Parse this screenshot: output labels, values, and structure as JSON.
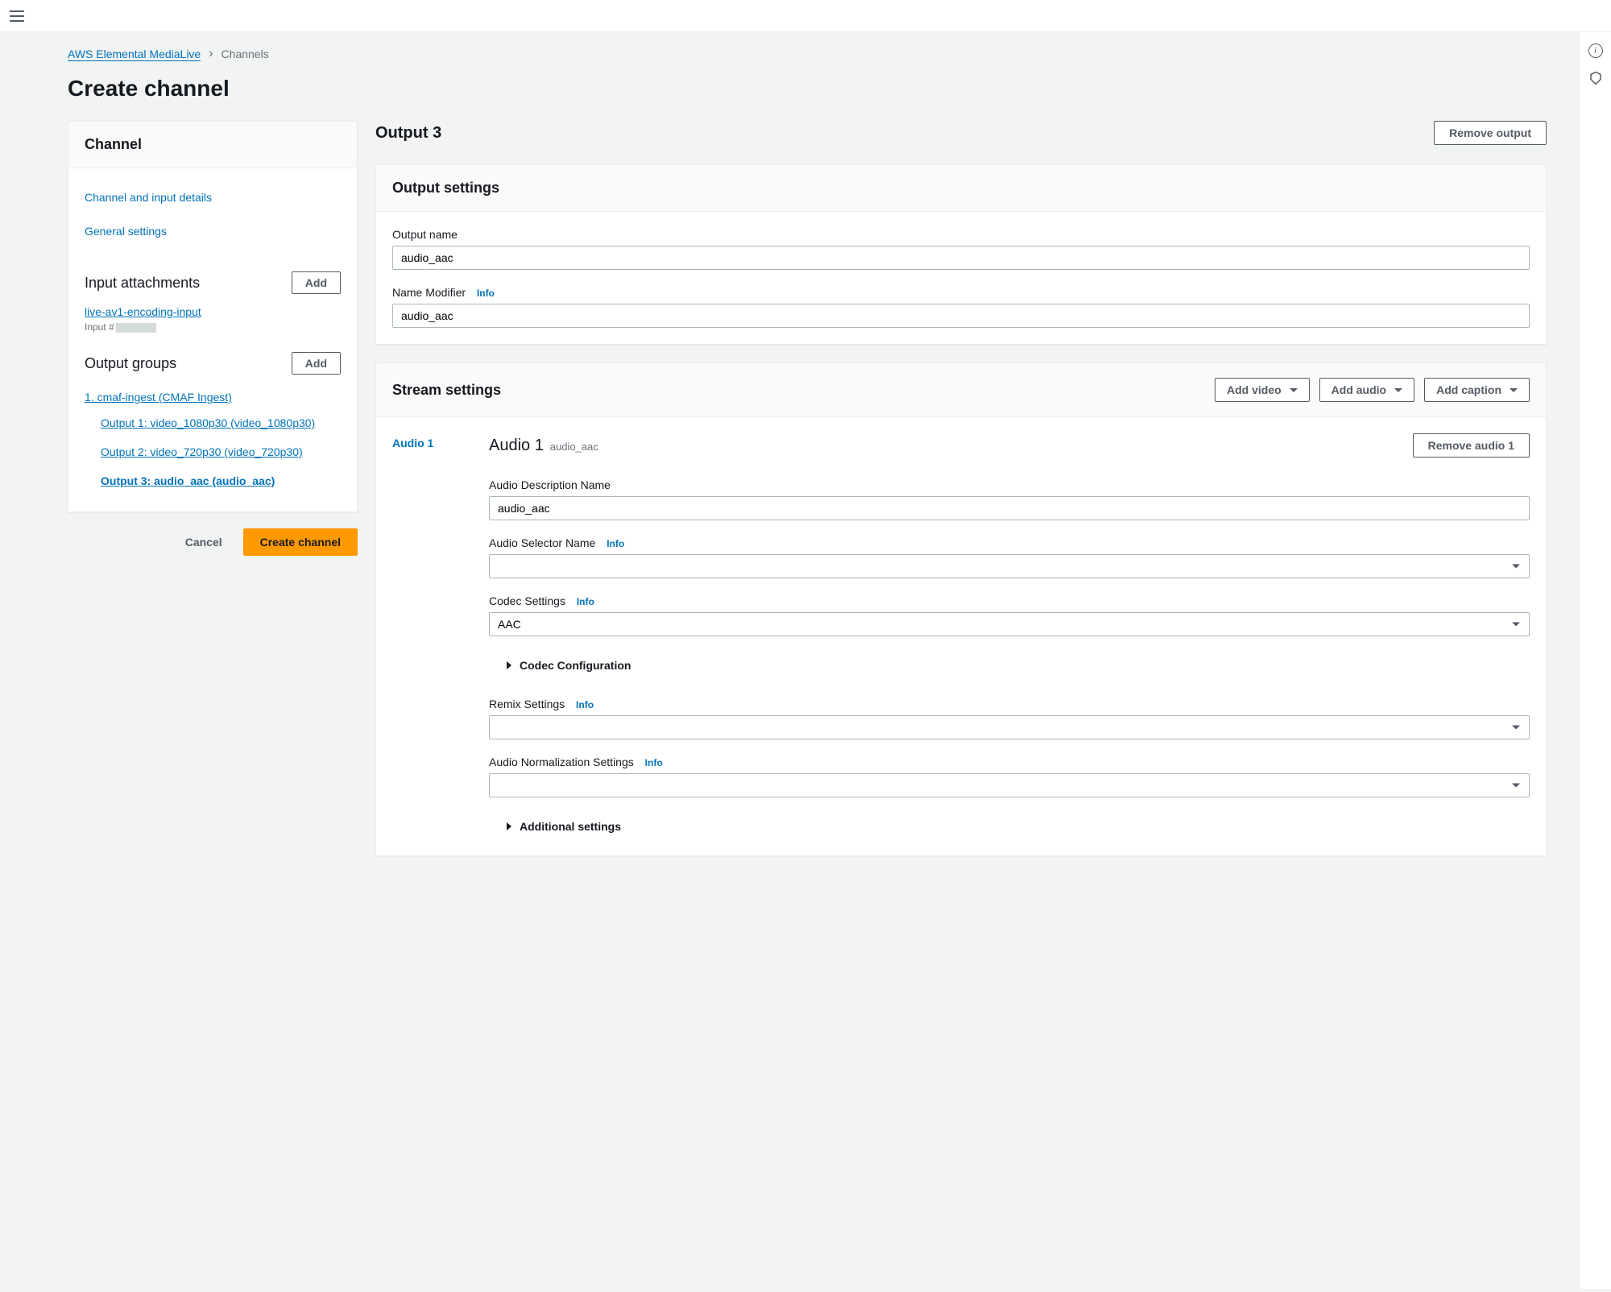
{
  "breadcrumb": {
    "service": "AWS Elemental MediaLive",
    "current": "Channels"
  },
  "page_title": "Create channel",
  "sidebar": {
    "title": "Channel",
    "nav_channel_input": "Channel and input details",
    "nav_general": "General settings",
    "input_attachments_heading": "Input attachments",
    "add_btn": "Add",
    "input_name": "live-av1-encoding-input",
    "input_prefix": "Input #",
    "output_groups_heading": "Output groups",
    "og_name": "1. cmaf-ingest (CMAF Ingest)",
    "outputs": [
      "Output 1: video_1080p30 (video_1080p30)",
      "Output 2: video_720p30 (video_720p30)",
      "Output 3: audio_aac (audio_aac)"
    ],
    "cancel_btn": "Cancel",
    "create_btn": "Create channel"
  },
  "content": {
    "header_title": "Output 3",
    "remove_output_btn": "Remove output",
    "output_settings": {
      "title": "Output settings",
      "output_name_label": "Output name",
      "output_name_value": "audio_aac",
      "name_modifier_label": "Name Modifier",
      "name_modifier_value": "audio_aac",
      "info": "Info"
    },
    "stream_settings": {
      "title": "Stream settings",
      "add_video_btn": "Add video",
      "add_audio_btn": "Add audio",
      "add_caption_btn": "Add caption",
      "tab_audio1": "Audio 1",
      "audio_heading": "Audio 1",
      "audio_sub": "audio_aac",
      "remove_audio_btn": "Remove audio 1",
      "audio_desc_label": "Audio Description Name",
      "audio_desc_value": "audio_aac",
      "audio_selector_label": "Audio Selector Name",
      "codec_settings_label": "Codec Settings",
      "codec_settings_value": "AAC",
      "codec_config_label": "Codec Configuration",
      "remix_label": "Remix Settings",
      "norm_label": "Audio Normalization Settings",
      "additional_label": "Additional settings",
      "info": "Info"
    }
  }
}
